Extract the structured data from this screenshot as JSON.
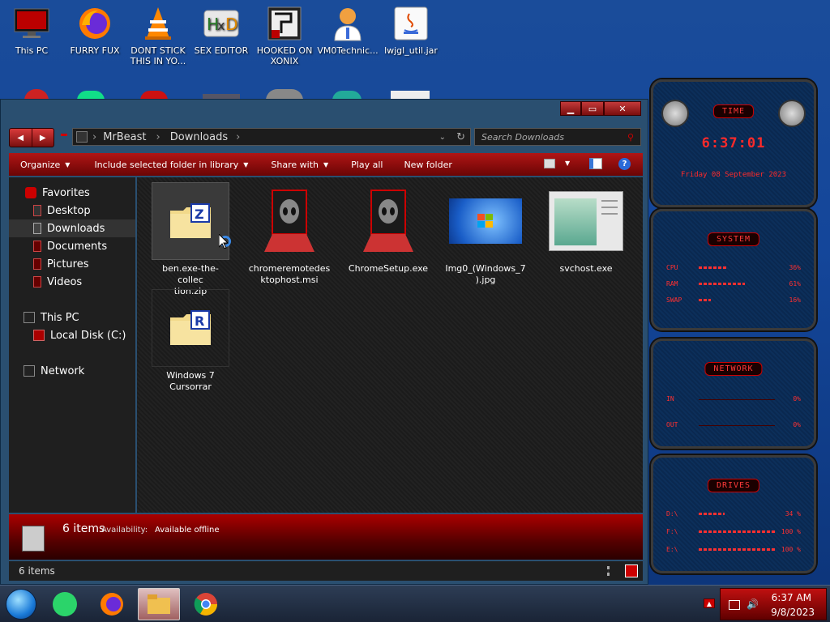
{
  "desktop": {
    "icons": [
      {
        "label": "This PC",
        "icon": "monitor-icon"
      },
      {
        "label": "FURRY FUX",
        "icon": "firefox-icon"
      },
      {
        "label": "DONT STICK THIS IN YO...",
        "icon": "vlc-cone-icon"
      },
      {
        "label": "SEX EDITOR",
        "icon": "hex-editor-icon"
      },
      {
        "label": "HOOKED ON XONIX",
        "icon": "game-icon"
      },
      {
        "label": "VM0Technic...",
        "icon": "doctor-avatar-icon"
      },
      {
        "label": "lwjgl_util.jar",
        "icon": "java-jar-icon"
      }
    ]
  },
  "window": {
    "caption_buttons": {
      "min": "▁",
      "max": "▭",
      "close": "✕"
    },
    "nav": {
      "back": "◀",
      "forward": "▶"
    },
    "address": {
      "segments": [
        "MrBeast",
        "Downloads"
      ],
      "separator": "›"
    },
    "search": {
      "placeholder": "Search Downloads"
    },
    "toolbar": {
      "organize": "Organize",
      "include": "Include selected folder in library",
      "share": "Share with",
      "playall": "Play all",
      "newfolder": "New folder"
    },
    "navpane": {
      "favorites": "Favorites",
      "desktop": "Desktop",
      "downloads": "Downloads",
      "documents": "Documents",
      "pictures": "Pictures",
      "videos": "Videos",
      "thispc": "This PC",
      "localdisk": "Local Disk (C:)",
      "network": "Network"
    },
    "files": [
      {
        "name": "ben.exe-the-collection.zip",
        "line1": "ben.exe-the-collec",
        "line2": "tion.zip",
        "type": "zip",
        "badge": "Z"
      },
      {
        "name": "chromeremotedesktophost.msi",
        "line1": "chromeremotedes",
        "line2": "ktophost.msi",
        "type": "alien"
      },
      {
        "name": "ChromeSetup.exe",
        "line1": "ChromeSetup.exe",
        "line2": "",
        "type": "alien"
      },
      {
        "name": "Img0_(Windows_7).jpg",
        "line1": "Img0_(Windows_7",
        "line2": ").jpg",
        "type": "win7"
      },
      {
        "name": "svchost.exe",
        "line1": "svchost.exe",
        "line2": "",
        "type": "doc"
      },
      {
        "name": "Windows 7 Cursorrar",
        "line1": "Windows 7",
        "line2": "Cursorrar",
        "type": "rar",
        "badge": "R"
      }
    ],
    "details": {
      "count": "6 items",
      "avail_label": "Availability:",
      "avail_value": "Available offline"
    },
    "status": {
      "count": "6 items"
    }
  },
  "gadget": {
    "time_title": "TIME",
    "time": "6:37:01",
    "date": "Friday 08 September 2023",
    "system_title": "SYSTEM",
    "system": [
      {
        "label": "CPU",
        "value": "36%",
        "fraction": 0.36
      },
      {
        "label": "RAM",
        "value": "61%",
        "fraction": 0.61
      },
      {
        "label": "SWAP",
        "value": "16%",
        "fraction": 0.16
      }
    ],
    "network_title": "NETWORK",
    "network": [
      {
        "label": "IN",
        "value": "0%",
        "fraction": 0
      },
      {
        "label": "OUT",
        "value": "0%",
        "fraction": 0
      }
    ],
    "drives_title": "DRIVES",
    "drives": [
      {
        "label": "D:\\",
        "value": "34 %",
        "fraction": 0.34
      },
      {
        "label": "F:\\",
        "value": "100 %",
        "fraction": 1
      },
      {
        "label": "E:\\",
        "value": "100 %",
        "fraction": 1
      }
    ]
  },
  "taskbar": {
    "time": "6:37 AM",
    "date": "9/8/2023"
  },
  "colors": {
    "accent": "#c01010",
    "nav_bg": "#1f1f1f",
    "desktop": "#14469a"
  }
}
